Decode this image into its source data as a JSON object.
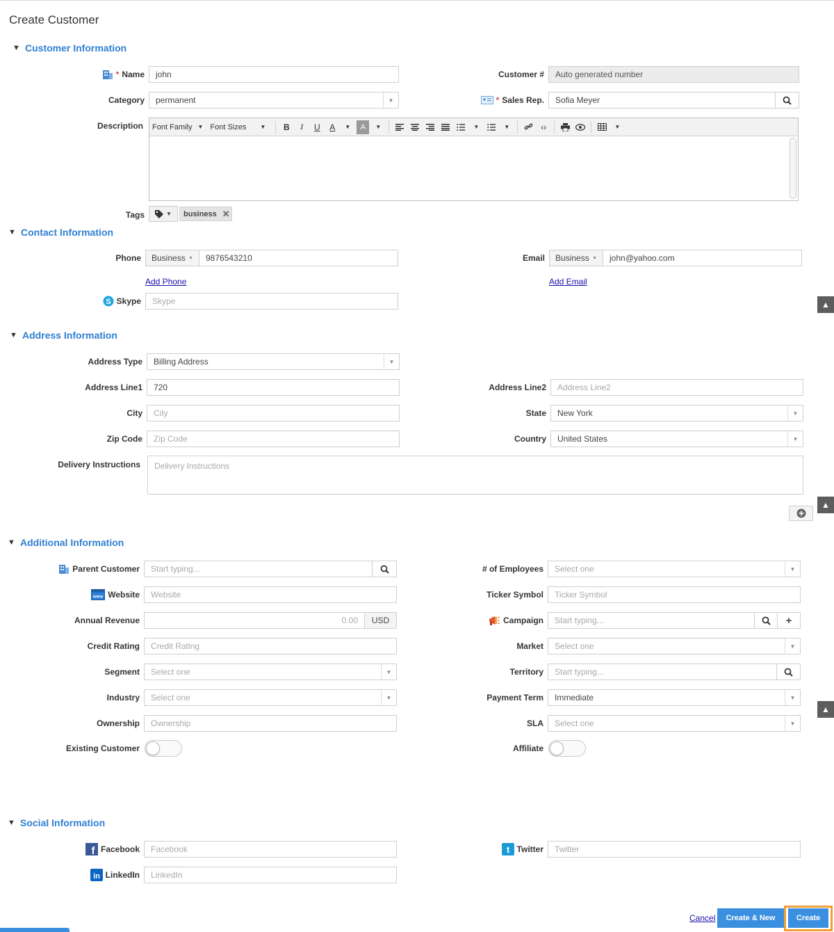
{
  "page": {
    "title": "Create Customer"
  },
  "sections": {
    "customer": "Customer Information",
    "contact": "Contact Information",
    "address": "Address Information",
    "additional": "Additional Information",
    "social": "Social Information"
  },
  "customer": {
    "name_label": "Name",
    "name_value": "john",
    "customer_no_label": "Customer #",
    "customer_no_value": "Auto generated number",
    "category_label": "Category",
    "category_value": "permanent",
    "sales_rep_label": "Sales Rep.",
    "sales_rep_value": "Sofia Meyer",
    "description_label": "Description",
    "toolbar": {
      "font_family": "Font Family",
      "font_sizes": "Font Sizes"
    },
    "tags_label": "Tags",
    "tag_value": "business"
  },
  "contact": {
    "phone_label": "Phone",
    "phone_type": "Business",
    "phone_value": "9876543210",
    "email_label": "Email",
    "email_type": "Business",
    "email_value": "john@yahoo.com",
    "add_phone": "Add Phone",
    "add_email": "Add Email",
    "skype_label": "Skype",
    "skype_placeholder": "Skype"
  },
  "address": {
    "type_label": "Address Type",
    "type_value": "Billing Address",
    "line1_label": "Address Line1",
    "line1_value": "720",
    "line2_label": "Address Line2",
    "line2_placeholder": "Address Line2",
    "city_label": "City",
    "city_placeholder": "City",
    "state_label": "State",
    "state_value": "New York",
    "zip_label": "Zip Code",
    "zip_placeholder": "Zip Code",
    "country_label": "Country",
    "country_value": "United States",
    "delivery_label": "Delivery Instructions",
    "delivery_placeholder": "Delivery Instructions"
  },
  "additional": {
    "parent_label": "Parent Customer",
    "parent_placeholder": "Start typing...",
    "employees_label": "# of Employees",
    "employees_value": "Select one",
    "website_label": "Website",
    "website_placeholder": "Website",
    "ticker_label": "Ticker Symbol",
    "ticker_placeholder": "Ticker Symbol",
    "revenue_label": "Annual Revenue",
    "revenue_value": "0.00",
    "revenue_currency": "USD",
    "campaign_label": "Campaign",
    "campaign_placeholder": "Start typing...",
    "credit_label": "Credit Rating",
    "credit_placeholder": "Credit Rating",
    "market_label": "Market",
    "market_value": "Select one",
    "segment_label": "Segment",
    "segment_value": "Select one",
    "territory_label": "Territory",
    "territory_placeholder": "Start typing...",
    "industry_label": "Industry",
    "industry_value": "Select one",
    "payment_label": "Payment Term",
    "payment_value": "Immediate",
    "ownership_label": "Ownership",
    "ownership_placeholder": "Ownership",
    "sla_label": "SLA",
    "sla_value": "Select one",
    "existing_label": "Existing Customer",
    "affiliate_label": "Affiliate"
  },
  "social": {
    "facebook_label": "Facebook",
    "facebook_placeholder": "Facebook",
    "twitter_label": "Twitter",
    "twitter_placeholder": "Twitter",
    "linkedin_label": "LinkedIn",
    "linkedin_placeholder": "LinkedIn"
  },
  "footer": {
    "cancel": "Cancel",
    "create_new": "Create & New",
    "create": "Create"
  },
  "colors": {
    "section": "#2f7fd1",
    "primary": "#3b8fe0",
    "highlight": "#f0a030"
  }
}
